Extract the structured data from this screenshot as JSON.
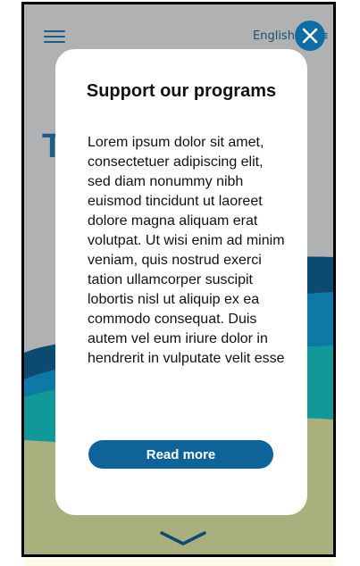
{
  "header": {
    "menu_icon": "menu-icon",
    "language_label": "English",
    "language_tail": "≡",
    "close_icon": "close-icon"
  },
  "background": {
    "heading": "T                d"
  },
  "modal": {
    "title": "Support our programs",
    "body": "Lorem ipsum dolor sit amet, consectetuer adipiscing elit, sed diam nonummy nibh euismod tincidunt ut laoreet dolore magna aliquam erat volutpat. Ut wisi enim ad minim veniam, quis nostrud exerci tation ullamcorper suscipit lobortis nisl ut aliquip ex ea commodo consequat. Duis autem vel eum iriure dolor in hendrerit in vulputate velit esse",
    "read_more_label": "Read more"
  },
  "footer": {
    "scroll_icon": "chevron-down-icon"
  },
  "colors": {
    "primary": "#0e6399",
    "overlay": "#b0b1b3",
    "wave_dark": "#0c4a72",
    "wave_mid": "#0e78a6",
    "wave_teal": "#11999a",
    "sand": "#a9b07e"
  }
}
